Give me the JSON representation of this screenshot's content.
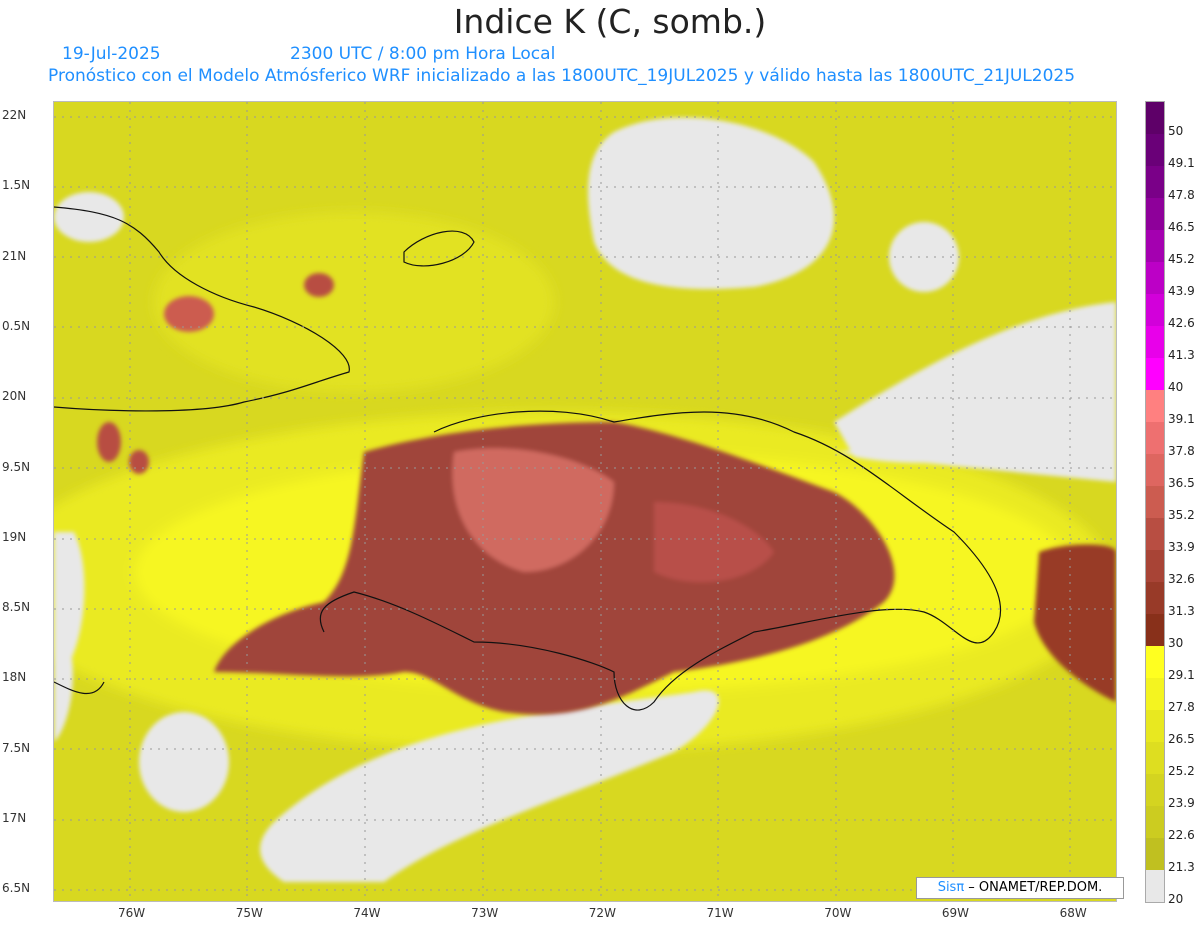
{
  "title": "Indice K (C, somb.)",
  "date": "19-Jul-2025",
  "time": "2300 UTC / 8:00 pm Hora Local",
  "subtitle": "Pronóstico con el Modelo Atmósferico WRF inicializado a las 1800UTC_19JUL2025 y válido hasta las  1800UTC_21JUL2025",
  "lat_labels": [
    "22N",
    "1.5N",
    "21N",
    "0.5N",
    "20N",
    "9.5N",
    "19N",
    "8.5N",
    "18N",
    "7.5N",
    "17N",
    "6.5N"
  ],
  "lon_labels": [
    "76W",
    "75W",
    "74W",
    "73W",
    "72W",
    "71W",
    "70W",
    "69W",
    "68W"
  ],
  "colorbar": {
    "labels": [
      "50",
      "49.1",
      "47.8",
      "46.5",
      "45.2",
      "43.9",
      "42.6",
      "41.3",
      "40",
      "39.1",
      "37.8",
      "36.5",
      "35.2",
      "33.9",
      "32.6",
      "31.3",
      "30",
      "29.1",
      "27.8",
      "26.5",
      "25.2",
      "23.9",
      "22.6",
      "21.3",
      "20"
    ],
    "colors": [
      "#5e0068",
      "#6a0078",
      "#7a0088",
      "#8e009a",
      "#a400b0",
      "#bc00c6",
      "#d200da",
      "#e800ea",
      "#ff00ff",
      "#ff8080",
      "#ee7070",
      "#de6660",
      "#cc5c50",
      "#b84e42",
      "#a84436",
      "#983a28",
      "#88301a",
      "#ffff20",
      "#f4f420",
      "#e8e820",
      "#dede20",
      "#d4d420",
      "#cccc20",
      "#c0c020",
      "#e8e8e8"
    ]
  },
  "credit": {
    "brand": "Sisπ",
    "text": " – ONAMET/REP.DOM."
  }
}
